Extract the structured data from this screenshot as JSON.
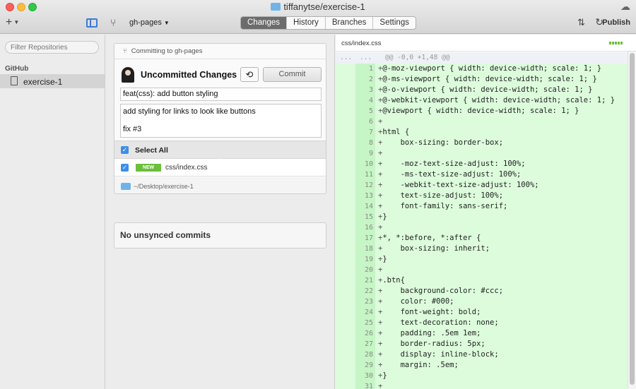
{
  "window": {
    "title": "tiffanytse/exercise-1"
  },
  "toolbar": {
    "add_label": "+",
    "branch_name": "gh-pages",
    "tabs": [
      {
        "label": "Changes",
        "active": true
      },
      {
        "label": "History",
        "active": false
      },
      {
        "label": "Branches",
        "active": false
      },
      {
        "label": "Settings",
        "active": false
      }
    ],
    "publish_label": "Publish"
  },
  "sidebar": {
    "filter_placeholder": "Filter Repositories",
    "section_label": "GitHub",
    "repos": [
      {
        "label": "exercise-1",
        "selected": true
      }
    ]
  },
  "commit_panel": {
    "header": "Committing to gh-pages",
    "title": "Uncommitted Changes",
    "commit_button": "Commit",
    "summary": "feat(css): add button styling",
    "description_lines": [
      "add styling for links to look like buttons",
      "",
      "fix #3"
    ],
    "select_all_label": "Select All",
    "files": [
      {
        "badge": "NEW",
        "name": "css/index.css",
        "checked": true
      }
    ],
    "repo_path": "~/Desktop/exercise-1"
  },
  "unsynced": {
    "label": "No unsynced commits"
  },
  "diff": {
    "filename": "css/index.css",
    "hunk_header": "@@ -0,0 +1,48 @@",
    "hunk_dots": "...",
    "added_color": "#dcfcdc",
    "lines": [
      {
        "num": "1",
        "text": "@-moz-viewport { width: device-width; scale: 1; }"
      },
      {
        "num": "2",
        "text": "@-ms-viewport { width: device-width; scale: 1; }"
      },
      {
        "num": "3",
        "text": "@-o-viewport { width: device-width; scale: 1; }"
      },
      {
        "num": "4",
        "text": "@-webkit-viewport { width: device-width; scale: 1; }"
      },
      {
        "num": "5",
        "text": "@viewport { width: device-width; scale: 1; }"
      },
      {
        "num": "6",
        "text": ""
      },
      {
        "num": "7",
        "text": "html {"
      },
      {
        "num": "8",
        "text": "    box-sizing: border-box;"
      },
      {
        "num": "9",
        "text": ""
      },
      {
        "num": "10",
        "text": "    -moz-text-size-adjust: 100%;"
      },
      {
        "num": "11",
        "text": "    -ms-text-size-adjust: 100%;"
      },
      {
        "num": "12",
        "text": "    -webkit-text-size-adjust: 100%;"
      },
      {
        "num": "13",
        "text": "    text-size-adjust: 100%;"
      },
      {
        "num": "14",
        "text": "    font-family: sans-serif;"
      },
      {
        "num": "15",
        "text": "}"
      },
      {
        "num": "16",
        "text": ""
      },
      {
        "num": "17",
        "text": "*, *:before, *:after {"
      },
      {
        "num": "18",
        "text": "    box-sizing: inherit;"
      },
      {
        "num": "19",
        "text": "}"
      },
      {
        "num": "20",
        "text": ""
      },
      {
        "num": "21",
        "text": ".btn{"
      },
      {
        "num": "22",
        "text": "    background-color: #ccc;"
      },
      {
        "num": "23",
        "text": "    color: #000;"
      },
      {
        "num": "24",
        "text": "    font-weight: bold;"
      },
      {
        "num": "25",
        "text": "    text-decoration: none;"
      },
      {
        "num": "26",
        "text": "    padding: .5em 1em;"
      },
      {
        "num": "27",
        "text": "    border-radius: 5px;"
      },
      {
        "num": "28",
        "text": "    display: inline-block;"
      },
      {
        "num": "29",
        "text": "    margin: .5em;"
      },
      {
        "num": "30",
        "text": "}"
      },
      {
        "num": "31",
        "text": ""
      }
    ]
  }
}
